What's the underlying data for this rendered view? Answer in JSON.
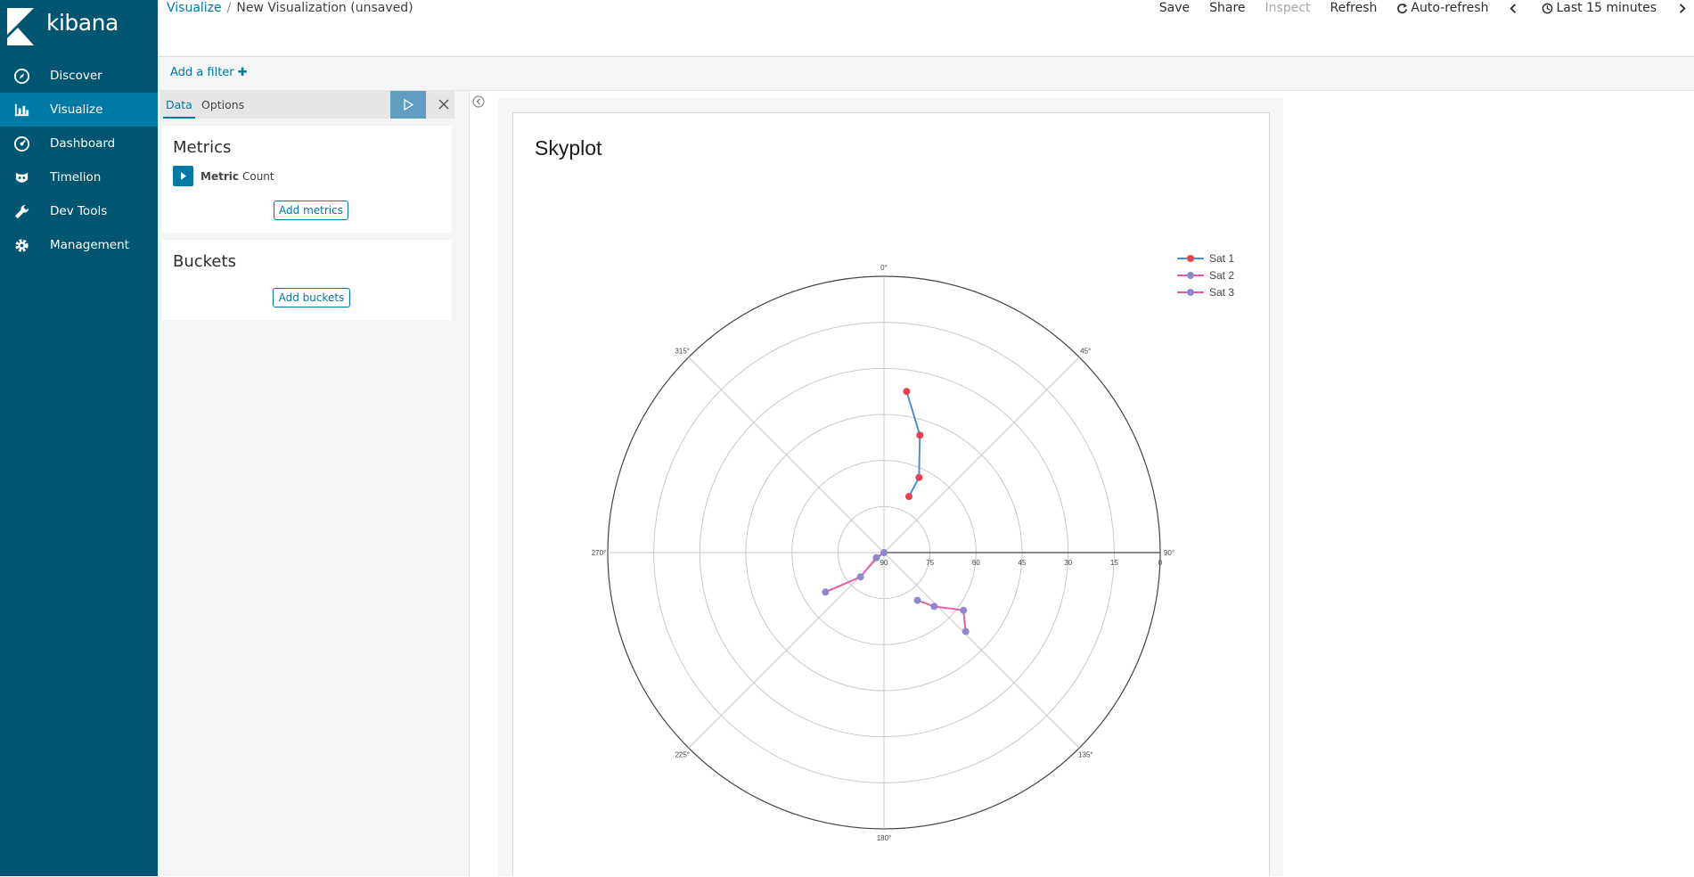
{
  "app": {
    "logo_text": "kibana"
  },
  "sidebar": {
    "items": [
      {
        "label": "Discover",
        "icon": "compass-icon"
      },
      {
        "label": "Visualize",
        "icon": "bar-chart-icon"
      },
      {
        "label": "Dashboard",
        "icon": "dashboard-icon"
      },
      {
        "label": "Timelion",
        "icon": "timelion-icon"
      },
      {
        "label": "Dev Tools",
        "icon": "wrench-icon"
      },
      {
        "label": "Management",
        "icon": "gear-icon"
      }
    ],
    "active_item": "Visualize"
  },
  "header": {
    "breadcrumb_root": "Visualize",
    "breadcrumb_sep": "/",
    "breadcrumb_current": "New Visualization (unsaved)",
    "menu": {
      "save": "Save",
      "share": "Share",
      "inspect": "Inspect",
      "refresh": "Refresh",
      "auto_refresh": "Auto-refresh",
      "time_range": "Last 15 minutes"
    }
  },
  "filter_bar": {
    "add_filter": "Add a filter"
  },
  "editor": {
    "tabs": [
      "Data",
      "Options"
    ],
    "active_tab": "Data",
    "metrics_title": "Metrics",
    "metric_label": "Metric",
    "metric_value": "Count",
    "add_metrics": "Add metrics",
    "buckets_title": "Buckets",
    "add_buckets": "Add buckets"
  },
  "visualization": {
    "title": "Skyplot"
  },
  "chart_data": {
    "type": "scatter",
    "subtype": "polar",
    "angular_ticks": [
      "0°",
      "45°",
      "90°",
      "135°",
      "180°",
      "225°",
      "270°",
      "315°"
    ],
    "radial_ticks": [
      "90",
      "75",
      "60",
      "45",
      "30",
      "15",
      "0"
    ],
    "radial_axis": "elevation (90 at center, 0 at edge)",
    "series": [
      {
        "name": "Sat 1",
        "color": "#e8424a",
        "line_color": "#4a90d9",
        "points": [
          {
            "az": 8,
            "el": 37
          },
          {
            "az": 17,
            "el": 50
          },
          {
            "az": 25,
            "el": 63
          },
          {
            "az": 24,
            "el": 70
          }
        ]
      },
      {
        "name": "Sat 2",
        "color": "#8b88cc",
        "line_color": "#e85aa6",
        "points": [
          {
            "az": 134,
            "el": 53
          },
          {
            "az": 126,
            "el": 58
          },
          {
            "az": 137,
            "el": 66
          },
          {
            "az": 145,
            "el": 71
          }
        ]
      },
      {
        "name": "Sat 3",
        "color": "#8b88cc",
        "line_color": "#e85aa6",
        "points": [
          {
            "az": 236,
            "el": 67
          },
          {
            "az": 224,
            "el": 79
          },
          {
            "az": 236,
            "el": 87
          },
          {
            "az": 236,
            "el": 90
          }
        ]
      }
    ],
    "legend_position": "top-right",
    "grid": true
  }
}
